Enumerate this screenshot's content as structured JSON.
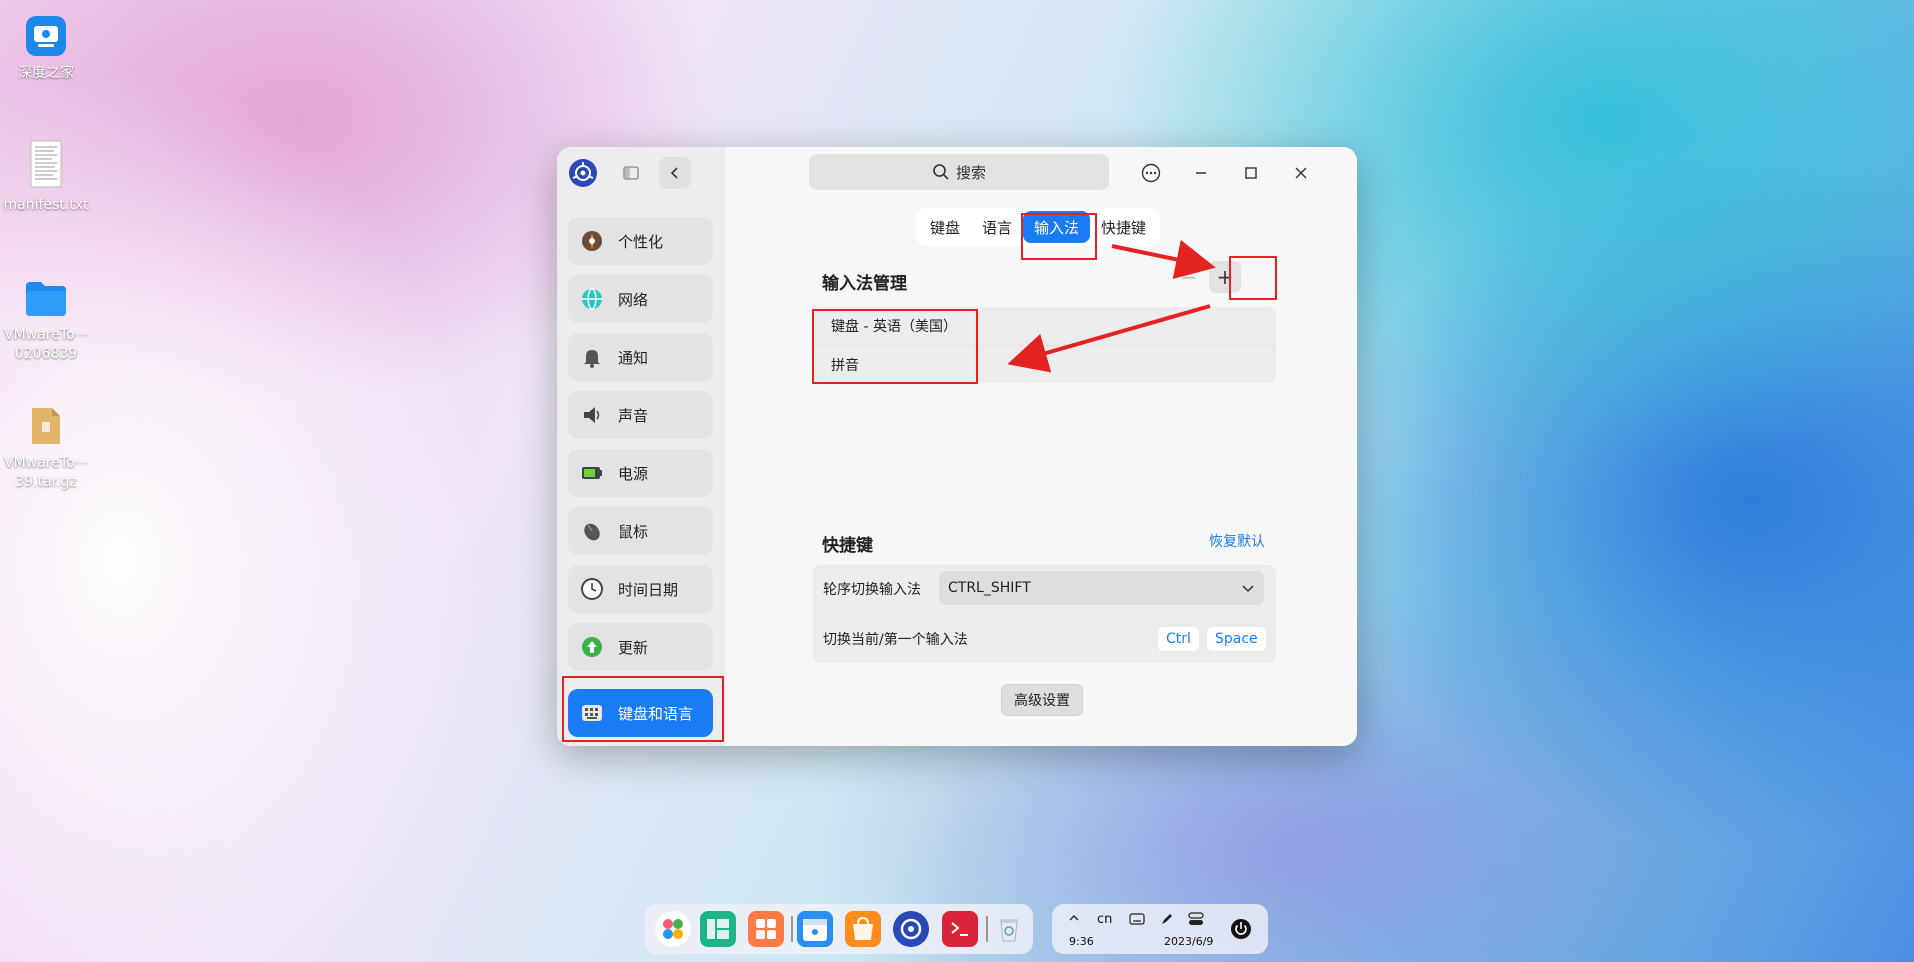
{
  "desktop": {
    "icons": [
      {
        "label": "深度之家"
      },
      {
        "label": "manifest.txt"
      },
      {
        "label": "VMwareTo···0206839"
      },
      {
        "label": "VMwareTo···39.tar.gz"
      }
    ]
  },
  "window": {
    "search_placeholder": "搜索",
    "sidebar": {
      "items": [
        {
          "label": "个性化"
        },
        {
          "label": "网络"
        },
        {
          "label": "通知"
        },
        {
          "label": "声音"
        },
        {
          "label": "电源"
        },
        {
          "label": "鼠标"
        },
        {
          "label": "时间日期"
        },
        {
          "label": "更新"
        },
        {
          "label": "键盘和语言"
        }
      ],
      "active_index": 8
    },
    "tabs": [
      {
        "label": "键盘"
      },
      {
        "label": "语言"
      },
      {
        "label": "输入法"
      },
      {
        "label": "快捷键"
      }
    ],
    "active_tab": 2,
    "im_manage": {
      "title": "输入法管理",
      "remove_label": "−",
      "add_label": "+",
      "items": [
        {
          "label": "键盘 - 英语（美国）"
        },
        {
          "label": "拼音"
        }
      ]
    },
    "shortcuts": {
      "title": "快捷键",
      "restore_label": "恢复默认",
      "cycle_label": "轮序切换输入法",
      "cycle_value": "CTRL_SHIFT",
      "switch_label": "切换当前/第一个输入法",
      "switch_keys": [
        "Ctrl",
        "Space"
      ]
    },
    "advanced_label": "高级设置"
  },
  "taskbar": {
    "lang": "cn",
    "time": "9:36",
    "date": "2023/6/9"
  },
  "colors": {
    "accent": "#1a7cf5",
    "highlight": "#e32222"
  }
}
